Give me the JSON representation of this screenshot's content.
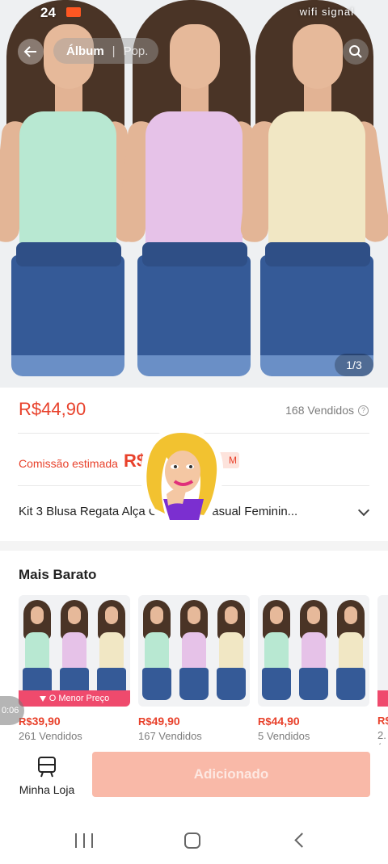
{
  "status_bar": {
    "time": "24",
    "right_icons": "wifi signal"
  },
  "header": {
    "tabs": [
      "Álbum",
      "Pop."
    ],
    "image_counter": "1/3"
  },
  "hero": {
    "colors": {
      "mint": "#b8e8d2",
      "lilac": "#e6c2e8",
      "cream": "#f1e7c4"
    }
  },
  "product": {
    "price": "R$44,90",
    "sold": "168 Vendidos",
    "help_icon": "?",
    "commission_label": "Comissão estimada",
    "commission_value": "R$",
    "commission_badge_partial": "M",
    "title": "Kit 3 Blusa Regata Alça Camiseta Casual Feminin..."
  },
  "cheaper": {
    "title": "Mais Barato",
    "badge": "O Menor Preço",
    "items": [
      {
        "currency": "R$",
        "price": "39,90",
        "sold": "261 Vendidos"
      },
      {
        "currency": "R$",
        "price": "49,90",
        "sold": "167 Vendidos"
      },
      {
        "currency": "R$",
        "price": "44,90",
        "sold": "5 Vendidos"
      }
    ],
    "partial_price": "R$",
    "partial_sold": "2.("
  },
  "timer": "0:06",
  "bottom": {
    "shop_label": "Minha Loja",
    "add_label": "Adicionado"
  },
  "icons": [
    "back-arrow-icon",
    "search-icon",
    "help-icon",
    "chevron-down-icon",
    "down-arrow-icon",
    "store-icon",
    "nav-recent-icon",
    "nav-home-icon",
    "nav-back-icon"
  ]
}
